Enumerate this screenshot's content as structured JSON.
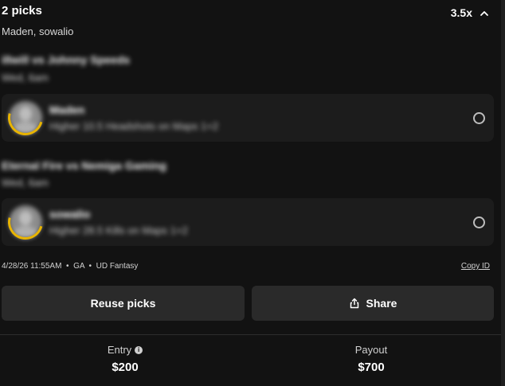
{
  "header": {
    "title": "2 picks",
    "subtitle": "Maden, sowalio",
    "multiplier": "3.5x"
  },
  "icons": {
    "collapse": "chevron-up-icon",
    "share": "share-icon",
    "info": "info-icon",
    "avatar": "player-avatar-icon",
    "radio": "radio-circle-icon"
  },
  "matches": [
    {
      "title": "illwill vs Johnny Speeds",
      "time": "Wed, 6am",
      "pick": {
        "player": "Maden",
        "line": "Higher 10.5 Headshots on Maps 1+2"
      }
    },
    {
      "title": "Eternal Fire vs Nemiga Gaming",
      "time": "Wed, 6am",
      "pick": {
        "player": "sowalio",
        "line": "Higher 28.5 Kills on Maps 1+2"
      }
    }
  ],
  "meta": {
    "datetime": "4/28/26 11:55AM",
    "state": "GA",
    "app": "UD Fantasy",
    "copy_id": "Copy ID"
  },
  "buttons": {
    "reuse": "Reuse picks",
    "share": "Share"
  },
  "footer": {
    "entry_label": "Entry",
    "entry_value": "$200",
    "payout_label": "Payout",
    "payout_value": "$700"
  },
  "colors": {
    "background": "#121212",
    "card": "#1c1c1c",
    "button": "#2a2a2a",
    "avatar_ring": "#e8b400"
  }
}
